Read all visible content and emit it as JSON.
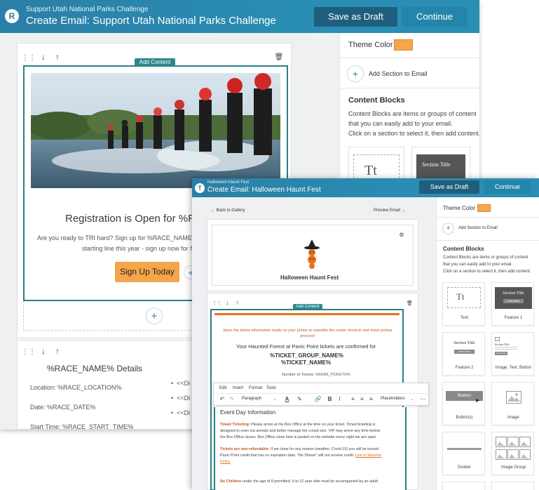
{
  "colors": {
    "header": "#2a8db3",
    "teal": "#2a8086",
    "orange": "#f5a54a",
    "theme_swatch": "#f5a54a"
  },
  "back": {
    "header": {
      "subtitle": "Support Utah National Parks Challenge",
      "title": "Create Email: Support Utah National Parks Challenge",
      "logo": "R",
      "save_draft": "Save as Draft",
      "continue": "Continue"
    },
    "editor": {
      "add_content": "Add Content",
      "registration_heading": "Registration is Open for %RAC",
      "body_line1": "Are you ready to TRI hard? Sign up for %RACE_NAME% today",
      "body_line2": "starting line this year - sign up now for fast tim",
      "signup_button": "Sign Up Today",
      "details_title": "%RACE_NAME% Details",
      "location": "Location: %RACE_LOCATION%",
      "date": "Date: %RACE_DATE%",
      "start_time": "Start Time: %RACE_START_TIME%",
      "bullets": [
        "<<Di",
        "<<Di",
        "<<Di"
      ]
    },
    "sidebar": {
      "theme_color_label": "Theme Color",
      "add_section": "Add Section to Email",
      "content_blocks_title": "Content Blocks",
      "content_blocks_desc1": "Content Blocks are items or groups of content",
      "content_blocks_desc2": "that you can easily add to your email.",
      "content_blocks_desc3": "Click on a section to select it, then add content.",
      "tile_text_glyph": "Tt",
      "tile_feature_title": "Section Title"
    }
  },
  "front": {
    "header": {
      "subtitle": "Halloween Haunt Fest",
      "title": "Create Email: Halloween Haunt Fest",
      "logo": "T",
      "save_draft": "Save as Draft",
      "continue": "Continue"
    },
    "nav": {
      "back": "← Back to Gallery",
      "preview": "Preview Email →"
    },
    "brand_name": "Halloween Haunt Fest",
    "editor": {
      "add_content": "Add Content",
      "notice": "Have the below information ready on your phone to expedite the onsite check-in and ticket pickup process!",
      "confirm_line": "Your Haunted Forest at Panic Point tickets are confirmed for",
      "ticket_group": "%TICKET_GROUP_NAME%",
      "ticket_name": "%TICKET_NAME%",
      "num_tickets": "Number of Tickets: %NUM_TICKETS%",
      "menu": [
        "Edit",
        "Insert",
        "Format",
        "Tools"
      ],
      "paragraph_select": "Paragraph",
      "placeholders_select": "Placeholders",
      "event_heading": "Event Day Information",
      "timed_label": "Timed Ticketing:",
      "timed_text_1": " Please arrive at the Box Office at the time on your ticket. Timed ticketing is",
      "timed_text_2": "designed to even out arrivals and better manage the crowd size. VIP may arrive any time before",
      "timed_text_3": "the Box Office closes. Box Office close time is posted on the website every night we are open.",
      "nonref_label": "Tickets are non-refundable:",
      "nonref_text_1": " If we close for any reason (weather, Covid-19) you will be issued",
      "nonref_text_2": "Panic Point credit that has no expiration date.  \"No Shows\" will not receive credit. ",
      "weather_link": "Link to Weather",
      "policy_link": "Policy",
      "children_label": "No Children",
      "children_text": " under the age of 8 permitted. 9 to 12 year olds must be accompanied by an adult."
    },
    "sidebar": {
      "theme_color_label": "Theme Color",
      "add_section": "Add Section to Email",
      "content_blocks_title": "Content Blocks",
      "desc1": "Content Blocks are items or groups of content",
      "desc2": "that you can easily add to your email.",
      "desc3": "Click on a section to select it, then add content.",
      "tiles": [
        {
          "label": "Text",
          "glyph": "Tt"
        },
        {
          "label": "Feature 1",
          "inner_title": "Section Title",
          "inner_btn": "Learn More"
        },
        {
          "label": "Feature 2",
          "inner_title": "Section Title",
          "inner_btn": "Learn More"
        },
        {
          "label": "Image, Text, Button",
          "inner_title": "Section Title",
          "inner_btn": "Learn More"
        },
        {
          "label": "Button(s)",
          "inner_btn": "Button"
        },
        {
          "label": "Image"
        },
        {
          "label": "Divider"
        },
        {
          "label": "Image Group"
        }
      ]
    }
  }
}
